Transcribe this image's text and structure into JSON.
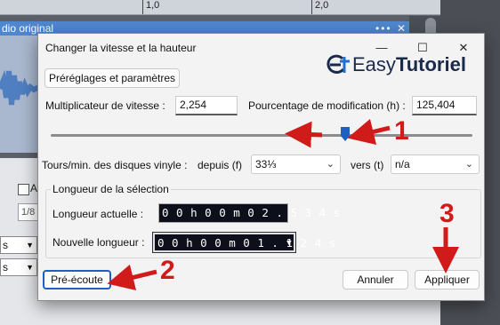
{
  "background": {
    "ruler_labels": [
      "1,0",
      "2,0"
    ],
    "track_name": "dio original",
    "track_controls": "•••  ✕",
    "checkbox_label": "A",
    "field_partial": "1/8",
    "dropdown_partial": "s"
  },
  "dialog": {
    "title": "Changer la vitesse et la hauteur",
    "presets_button": "Préréglages et paramètres",
    "speed_multiplier_label": "Multiplicateur de vitesse :",
    "speed_multiplier_value": "2,254",
    "percent_change_label": "Pourcentage de modification (h) :",
    "percent_change_value": "125,404",
    "vinyl_rpm_label": "Tours/min. des disques vinyle :",
    "from_label": "depuis (f)",
    "from_value": "33⅓",
    "to_label": "vers (t)",
    "to_value": "n/a",
    "selection_length_group": "Longueur de la sélection",
    "current_length_label": "Longueur actuelle :",
    "current_length_value": "0 0 h 0 0 m 0 2 . 5 3 4 s",
    "new_length_label": "Nouvelle longueur :",
    "new_length_value": "0 0 h 0 0 m 0 1 . 1 2 4 s",
    "preview_button": "Pré-écoute",
    "cancel_button": "Annuler",
    "apply_button": "Appliquer",
    "slider_percent": 125.404
  },
  "logo": {
    "text_prefix": "Easy",
    "text_bold": "Tutoriel",
    "mark": "et"
  },
  "annotations": {
    "step1": "1",
    "step2": "2",
    "step3": "3"
  },
  "colors": {
    "track_header": "#4f87ce",
    "slider_thumb": "#1f5fbf",
    "annotation_red": "#d11a1a",
    "time_field_bg": "#0d0f1a"
  },
  "icons": [
    "minimize-icon",
    "maximize-icon",
    "close-icon",
    "chevron-down-icon",
    "arrow-icon"
  ]
}
